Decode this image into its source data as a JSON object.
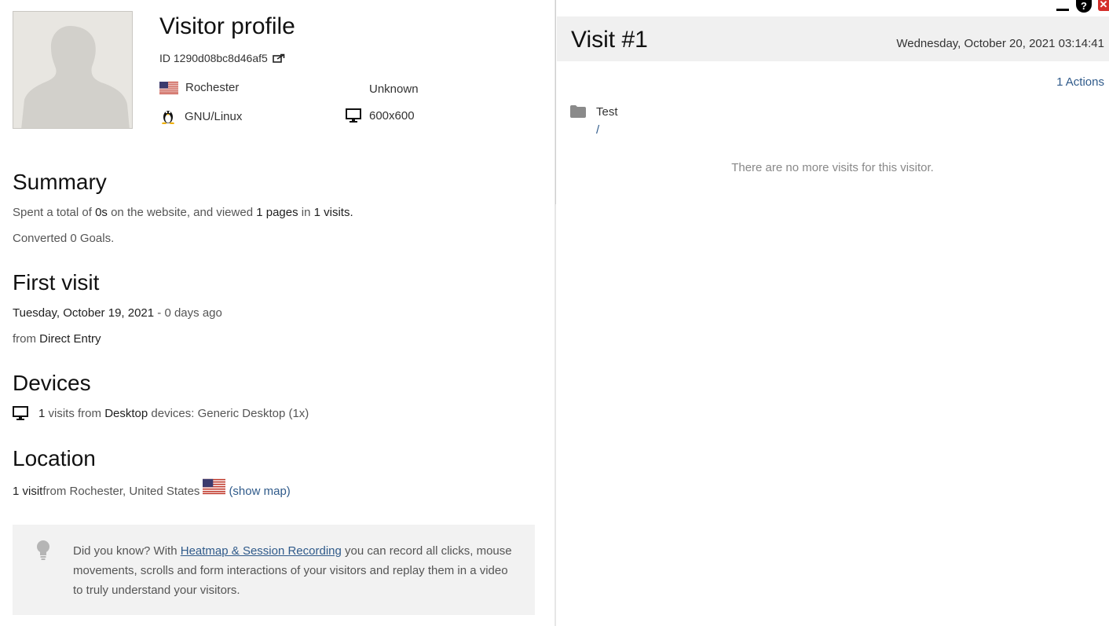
{
  "window": {
    "help_glyph": "?",
    "close_glyph": "✕"
  },
  "profile": {
    "title": "Visitor profile",
    "id_label": "ID 1290d08bc8d46af5",
    "city": "Rochester",
    "other": "Unknown",
    "os": "GNU/Linux",
    "resolution": "600x600"
  },
  "summary": {
    "title": "Summary",
    "p1": "Spent a total of ",
    "time": "0s",
    "p2": " on the website, and viewed ",
    "pages": "1 pages",
    "p3": " in ",
    "visits": "1 visits.",
    "goals": "Converted 0 Goals."
  },
  "first_visit": {
    "title": "First visit",
    "date": "Tuesday, October 19, 2021",
    "ago": " - 0 days ago",
    "from_label": "from ",
    "source": "Direct Entry"
  },
  "devices": {
    "title": "Devices",
    "count": "1",
    "p1": " visits from ",
    "type": "Desktop",
    "p2": " devices: Generic Desktop (1x)"
  },
  "location": {
    "title": "Location",
    "count": "1 visit",
    "text": " from Rochester, United States ",
    "map_link": "(show map)"
  },
  "tip": {
    "p1": "Did you know? With ",
    "link": "Heatmap & Session Recording",
    "p2": " you can record all clicks, mouse movements, scrolls and form interactions of your visitors and replay them in a video to truly understand your visitors."
  },
  "visit": {
    "title": "Visit #1",
    "date": "Wednesday, October 20, 2021 03:14:41",
    "actions": "1 Actions",
    "page_title": "Test",
    "page_url": "/",
    "no_more": "There are no more visits for this visitor."
  },
  "colors": {
    "link": "#2f5a8a",
    "panel_bg": "#f0f0f0",
    "close": "#d4302b"
  },
  "icons": [
    "external-link-icon",
    "us-flag-icon",
    "linux-icon",
    "desktop-icon",
    "folder-icon",
    "lightbulb-icon",
    "minimize-icon",
    "help-icon",
    "close-icon"
  ]
}
